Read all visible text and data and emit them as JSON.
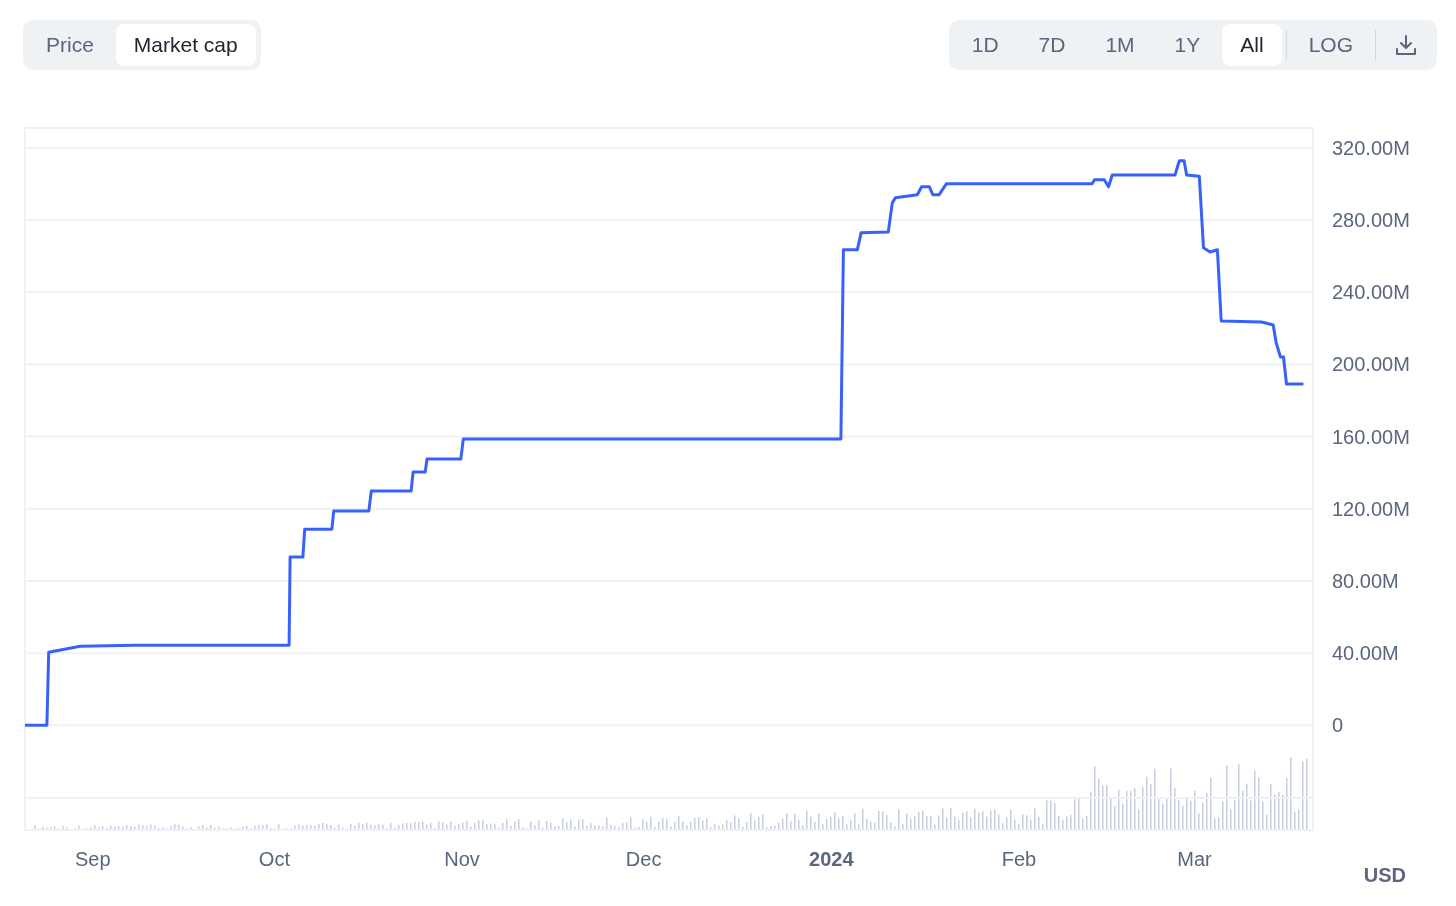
{
  "metric_tabs": [
    {
      "label": "Price",
      "selected": false
    },
    {
      "label": "Market cap",
      "selected": true
    }
  ],
  "range_tabs": [
    {
      "label": "1D",
      "selected": false
    },
    {
      "label": "7D",
      "selected": false
    },
    {
      "label": "1M",
      "selected": false
    },
    {
      "label": "1Y",
      "selected": false
    },
    {
      "label": "All",
      "selected": true
    }
  ],
  "scale_toggle": {
    "label": "LOG",
    "selected": false
  },
  "chart": {
    "currency": "USD",
    "chart_data": {
      "type": "line",
      "x": [
        "2023-08-20T19:00",
        "2023-08-24T10:00",
        "2023-08-24T17:00",
        "2023-08-29T22:00",
        "2023-09-07T22:00",
        "2023-10-03T10:00",
        "2023-10-03T14:00",
        "2023-10-05T17:00",
        "2023-10-06T00:00",
        "2023-10-10T12:00",
        "2023-10-10T19:00",
        "2023-10-16T14:00",
        "2023-10-17T00:00",
        "2023-10-23T14:00",
        "2023-10-23T22:00",
        "2023-10-25T22:00",
        "2023-10-26T05:00",
        "2023-10-31T19:00",
        "2023-11-01T05:00",
        "2024-01-02T14:00",
        "2024-01-03T00:00",
        "2024-01-05T07:00",
        "2024-01-05T22:00",
        "2024-01-10T10:00",
        "2024-01-11T02:00",
        "2024-01-11T14:00",
        "2024-01-15T05:00",
        "2024-01-15T22:00",
        "2024-01-17T05:00",
        "2024-01-17T19:00",
        "2024-01-18T19:00",
        "2024-01-20T00:00",
        "2024-02-13T02:00",
        "2024-02-13T12:00",
        "2024-02-15T02:00",
        "2024-02-15T19:00",
        "2024-02-16T10:00",
        "2024-02-26T19:00",
        "2024-02-27T12:00",
        "2024-02-28T07:00",
        "2024-02-28T17:00",
        "2024-03-01T19:00",
        "2024-03-02T12:00",
        "2024-03-03T14:00",
        "2024-03-04T19:00",
        "2024-03-05T10:00",
        "2024-03-12T02:00",
        "2024-03-14T00:00",
        "2024-03-14T12:00",
        "2024-03-15T05:00",
        "2024-03-15T17:00",
        "2024-03-16T05:00",
        "2024-03-19T00:00"
      ],
      "series": [
        {
          "color": "#3861fb",
          "values": [
            0,
            0,
            40.5,
            43.8,
            44.4,
            44.4,
            93.2,
            93.2,
            108.7,
            108.7,
            118.7,
            118.7,
            129.8,
            129.8,
            140.3,
            140.3,
            147.5,
            147.5,
            158.6,
            158.6,
            263.5,
            263.5,
            272.9,
            273.4,
            289.5,
            292.3,
            294.0,
            298.4,
            298.4,
            294.0,
            294.0,
            300.1,
            300.1,
            302.3,
            302.3,
            298.4,
            304.9,
            304.9,
            312.8,
            312.8,
            304.9,
            304.3,
            264.6,
            262.3,
            263.5,
            224.1,
            223.5,
            221.9,
            211.9,
            204.1,
            204.1,
            189.1,
            189.1
          ]
        }
      ],
      "grid": true,
      "xlim": [
        "2023-08-20T19:00",
        "2024-03-20T14:00"
      ],
      "ylim": [
        -58,
        331
      ],
      "xticks": [
        {
          "value": "2023-09-01",
          "label": "Sep"
        },
        {
          "value": "2023-10-01",
          "label": "Oct"
        },
        {
          "value": "2023-11-01",
          "label": "Nov"
        },
        {
          "value": "2023-12-01",
          "label": "Dec"
        },
        {
          "value": "2024-01-01",
          "label": "2024"
        },
        {
          "value": "2024-02-01",
          "label": "Feb"
        },
        {
          "value": "2024-03-01",
          "label": "Mar"
        }
      ],
      "yticks": [
        {
          "value": 0,
          "label": "0"
        },
        {
          "value": 40,
          "label": "40.00M"
        },
        {
          "value": 80,
          "label": "80.00M"
        },
        {
          "value": 120,
          "label": "120.00M"
        },
        {
          "value": 160,
          "label": "160.00M"
        },
        {
          "value": 200,
          "label": "200.00M"
        },
        {
          "value": 240,
          "label": "240.00M"
        },
        {
          "value": 280,
          "label": "280.00M"
        },
        {
          "value": 320,
          "label": "320.00M"
        }
      ]
    }
  }
}
